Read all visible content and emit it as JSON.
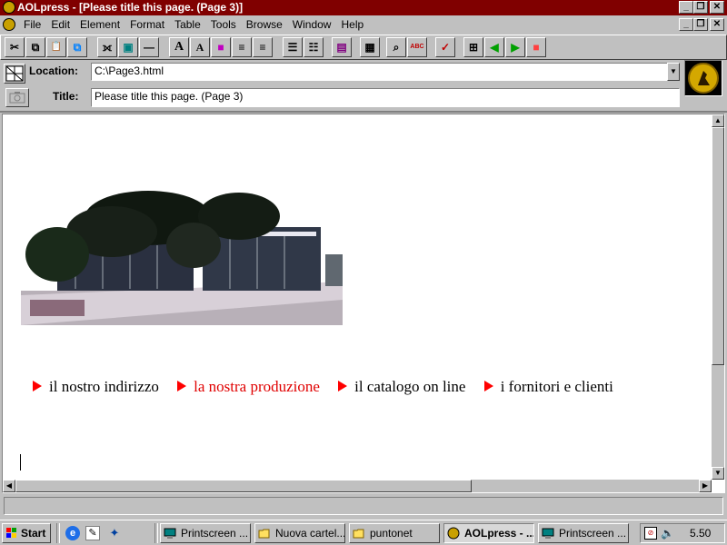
{
  "window": {
    "title": "AOLpress - [Please title this page. (Page 3)]",
    "caption_buttons": [
      "_",
      "❐",
      "✕"
    ]
  },
  "menu": {
    "items": [
      "File",
      "Edit",
      "Element",
      "Format",
      "Table",
      "Tools",
      "Browse",
      "Window",
      "Help"
    ]
  },
  "toolbar": {
    "icons": [
      "cut-icon",
      "copy-icon",
      "paste-icon",
      "paste-special-icon",
      "link-icon",
      "image-icon",
      "horizontal-rule-icon",
      "text-bigger-icon",
      "text-smaller-icon",
      "color-icon",
      "align-left-icon",
      "align-center-icon",
      "bullet-list-icon",
      "numbered-list-icon",
      "page-icon",
      "table-icon",
      "find-icon",
      "spell-check-icon",
      "link-check-icon",
      "map-icon",
      "back-icon",
      "forward-icon",
      "stop-icon"
    ],
    "glyphs": [
      "✂",
      "⧉",
      "📋",
      "⧉",
      "⟗",
      "▣",
      "—",
      "A",
      "A",
      "■",
      "≡",
      "≡",
      "☰",
      "☷",
      "▤",
      "▦",
      "⌕",
      "ABC",
      "✓",
      "⊞",
      "◀",
      "▶",
      "■"
    ]
  },
  "location": {
    "label": "Location:",
    "value": "C:\\Page3.html"
  },
  "title_field": {
    "label": "Title:",
    "value": "Please title this page. (Page 3)"
  },
  "page": {
    "photo_alt": "building",
    "links": [
      {
        "label": "il nostro indirizzo",
        "color": "#000000"
      },
      {
        "label": "la nostra produzione",
        "color": "#e00000"
      },
      {
        "label": "il catalogo on line",
        "color": "#000000"
      },
      {
        "label": "i fornitori e clienti",
        "color": "#000000"
      }
    ]
  },
  "taskbar": {
    "start_label": "Start",
    "tasks": [
      {
        "label": "Printscreen ...",
        "icon": "printscreen-icon"
      },
      {
        "label": "Nuova cartel...",
        "icon": "folder-icon"
      },
      {
        "label": "puntonet",
        "icon": "folder-icon"
      },
      {
        "label": "AOLpress - ...",
        "icon": "aolpress-icon",
        "active": true
      },
      {
        "label": "Printscreen ...",
        "icon": "printscreen-icon"
      }
    ],
    "clock": "5.50"
  }
}
